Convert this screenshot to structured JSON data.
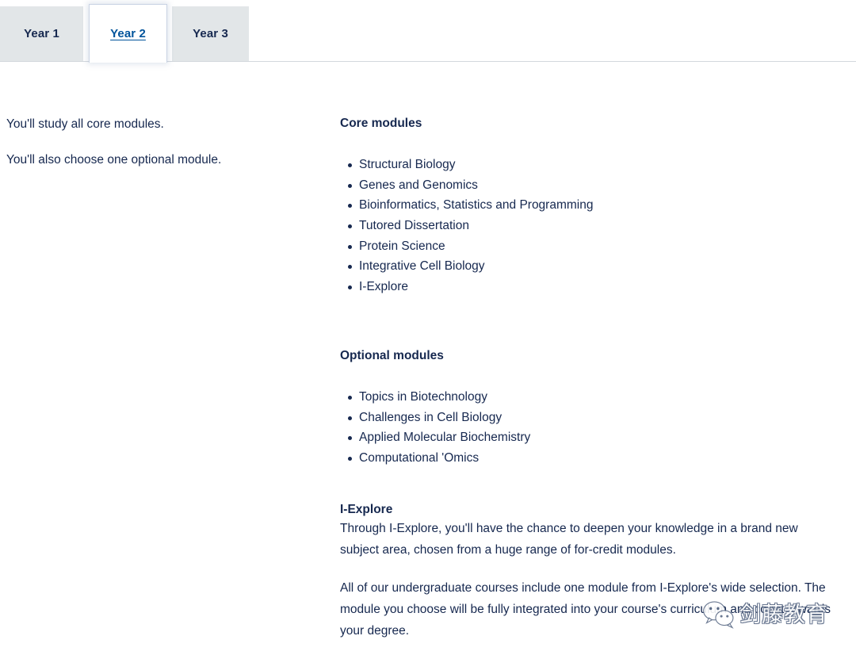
{
  "tabs": [
    {
      "id": "year1",
      "label": "Year 1",
      "active": false
    },
    {
      "id": "year2",
      "label": "Year 2",
      "active": true
    },
    {
      "id": "year3",
      "label": "Year 3",
      "active": false
    }
  ],
  "left_column": {
    "paragraph_1": "You'll study all core modules.",
    "paragraph_2": "You'll also choose one optional module."
  },
  "core_modules": {
    "title": "Core modules",
    "items": [
      "Structural Biology",
      "Genes and Genomics",
      "Bioinformatics, Statistics and Programming",
      "Tutored Dissertation",
      "Protein Science",
      "Integrative Cell Biology",
      "I-Explore"
    ]
  },
  "optional_modules": {
    "title": "Optional modules",
    "items": [
      "Topics in Biotechnology",
      "Challenges in Cell Biology",
      "Applied Molecular Biochemistry",
      "Computational 'Omics"
    ]
  },
  "iexplore": {
    "title": "I-Explore",
    "paragraph_1": "Through I-Explore, you'll have the chance to deepen your knowledge in a brand new subject area, chosen from a huge range of for-credit modules.",
    "paragraph_2": "All of our undergraduate courses include one module from I-Explore's wide selection. The module you choose will be fully integrated into your course's curriculum and count towards your degree."
  },
  "watermark": {
    "text": "剑藤教育",
    "logo": "wechat-icon"
  },
  "colors": {
    "text_navy": "#16284f",
    "link_blue": "#00539b",
    "tab_inactive_bg": "#e2e6e8",
    "tab_active_border": "#c9d3e4",
    "rule": "#d3d8dd",
    "page_bg": "#ffffff"
  }
}
